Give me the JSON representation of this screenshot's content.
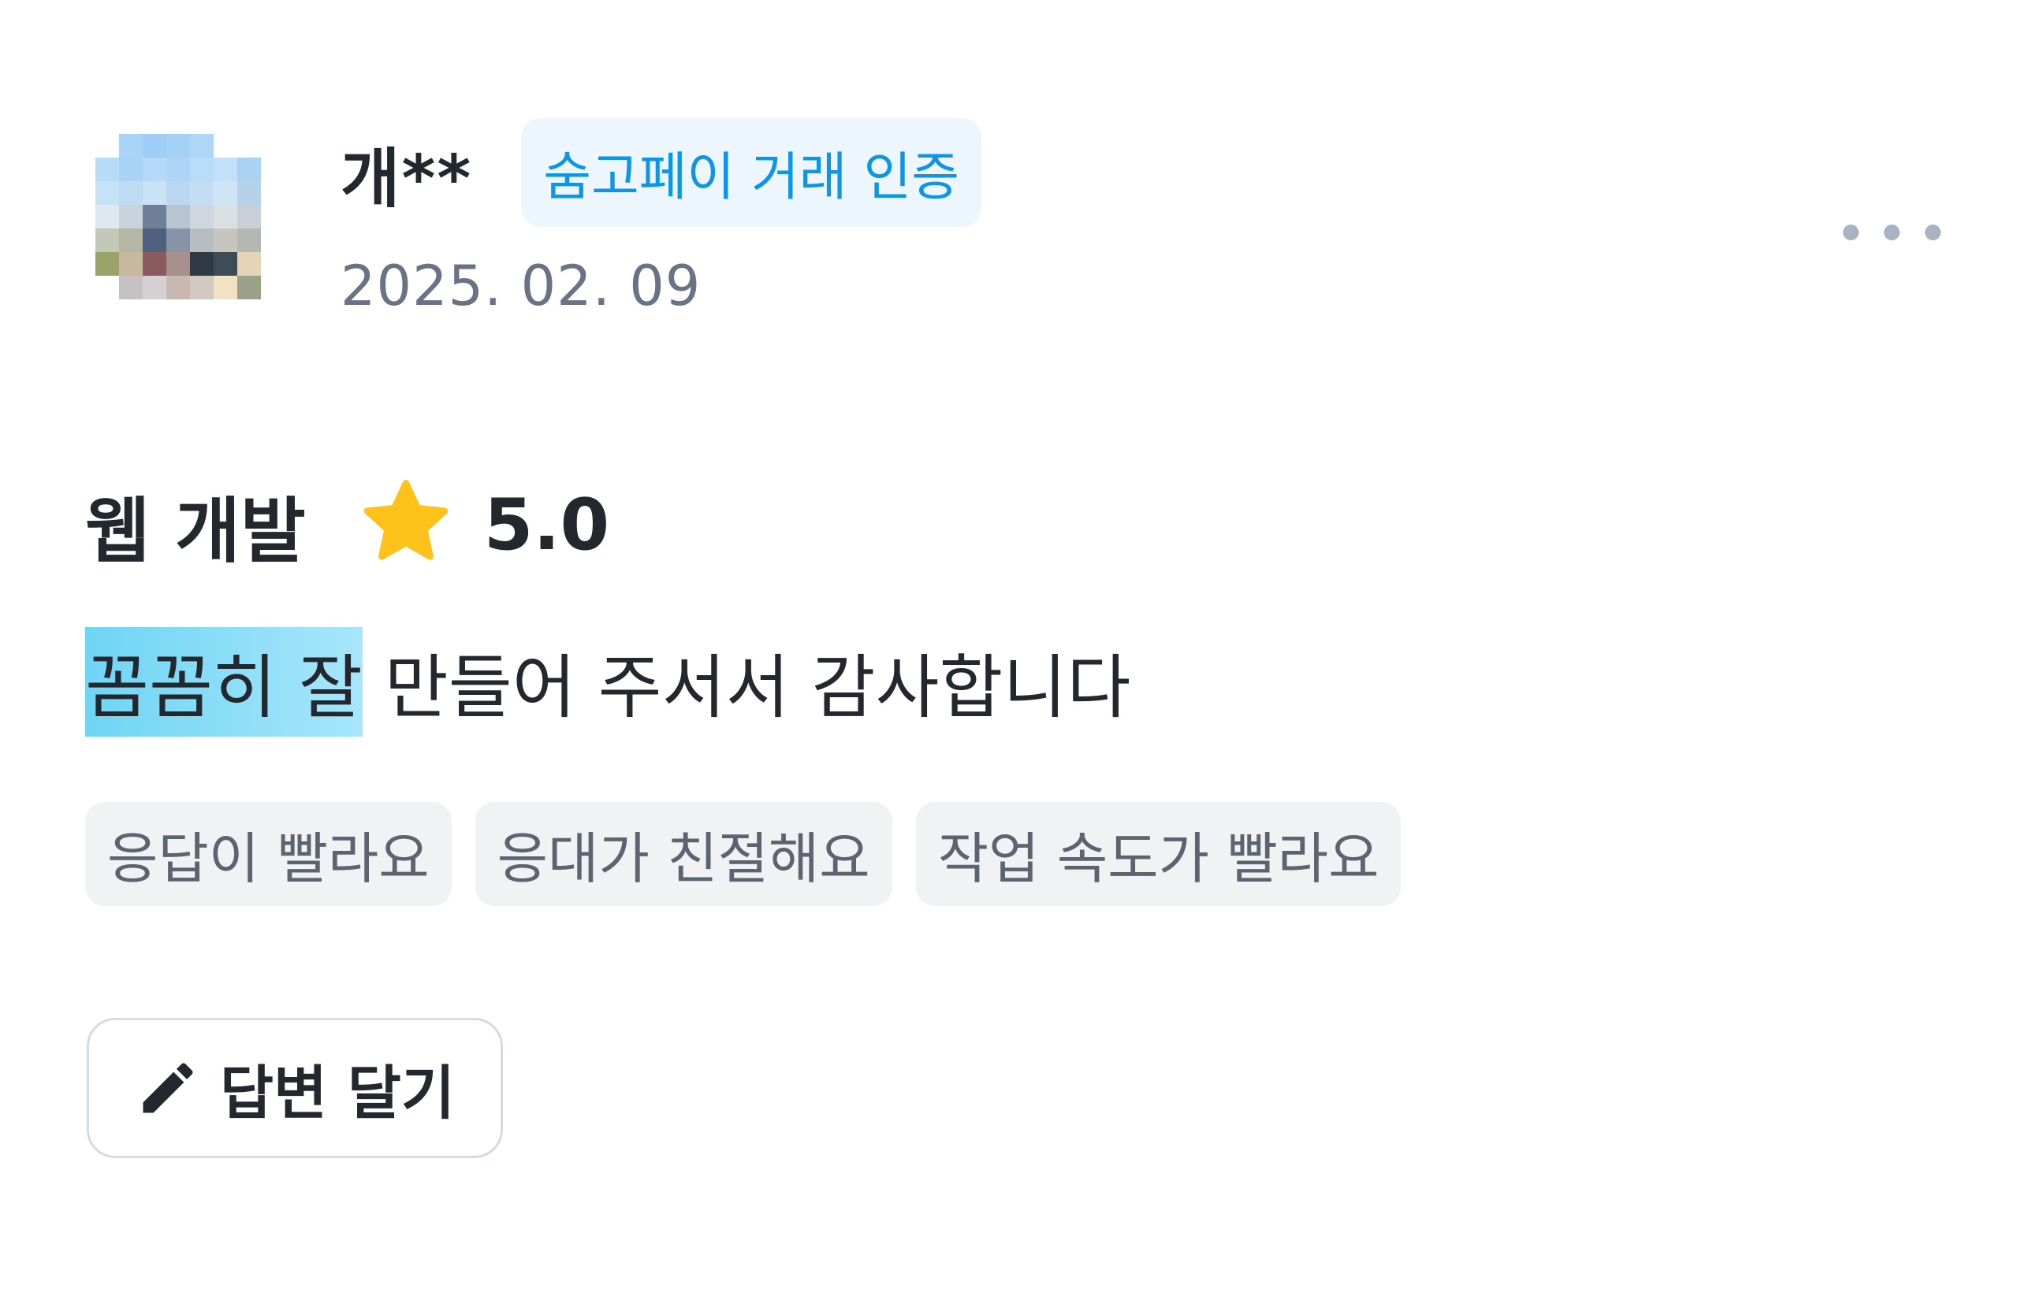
{
  "review": {
    "username": "개**",
    "verified_badge": "숨고페이 거래 인증",
    "date": "2025. 02. 09",
    "service": "웹 개발",
    "rating_value": 5.0,
    "rating_text": "5.0",
    "text_highlighted": "꼼꼼히 잘",
    "text_rest": " 만들어 주서서 감사합니다",
    "tags": [
      "응답이 빨라요",
      "응대가 친절해요",
      "작업 속도가 빨라요"
    ]
  },
  "actions": {
    "reply_label": "답변 달기"
  },
  "icons": {
    "more": "more-horizontal-icon",
    "star": "star-icon",
    "pencil": "pencil-icon"
  },
  "colors": {
    "badge_text": "#0d96e8",
    "badge_bg": "#eef6fd",
    "star": "#ffc21a",
    "highlight": "#7fdaf6"
  }
}
